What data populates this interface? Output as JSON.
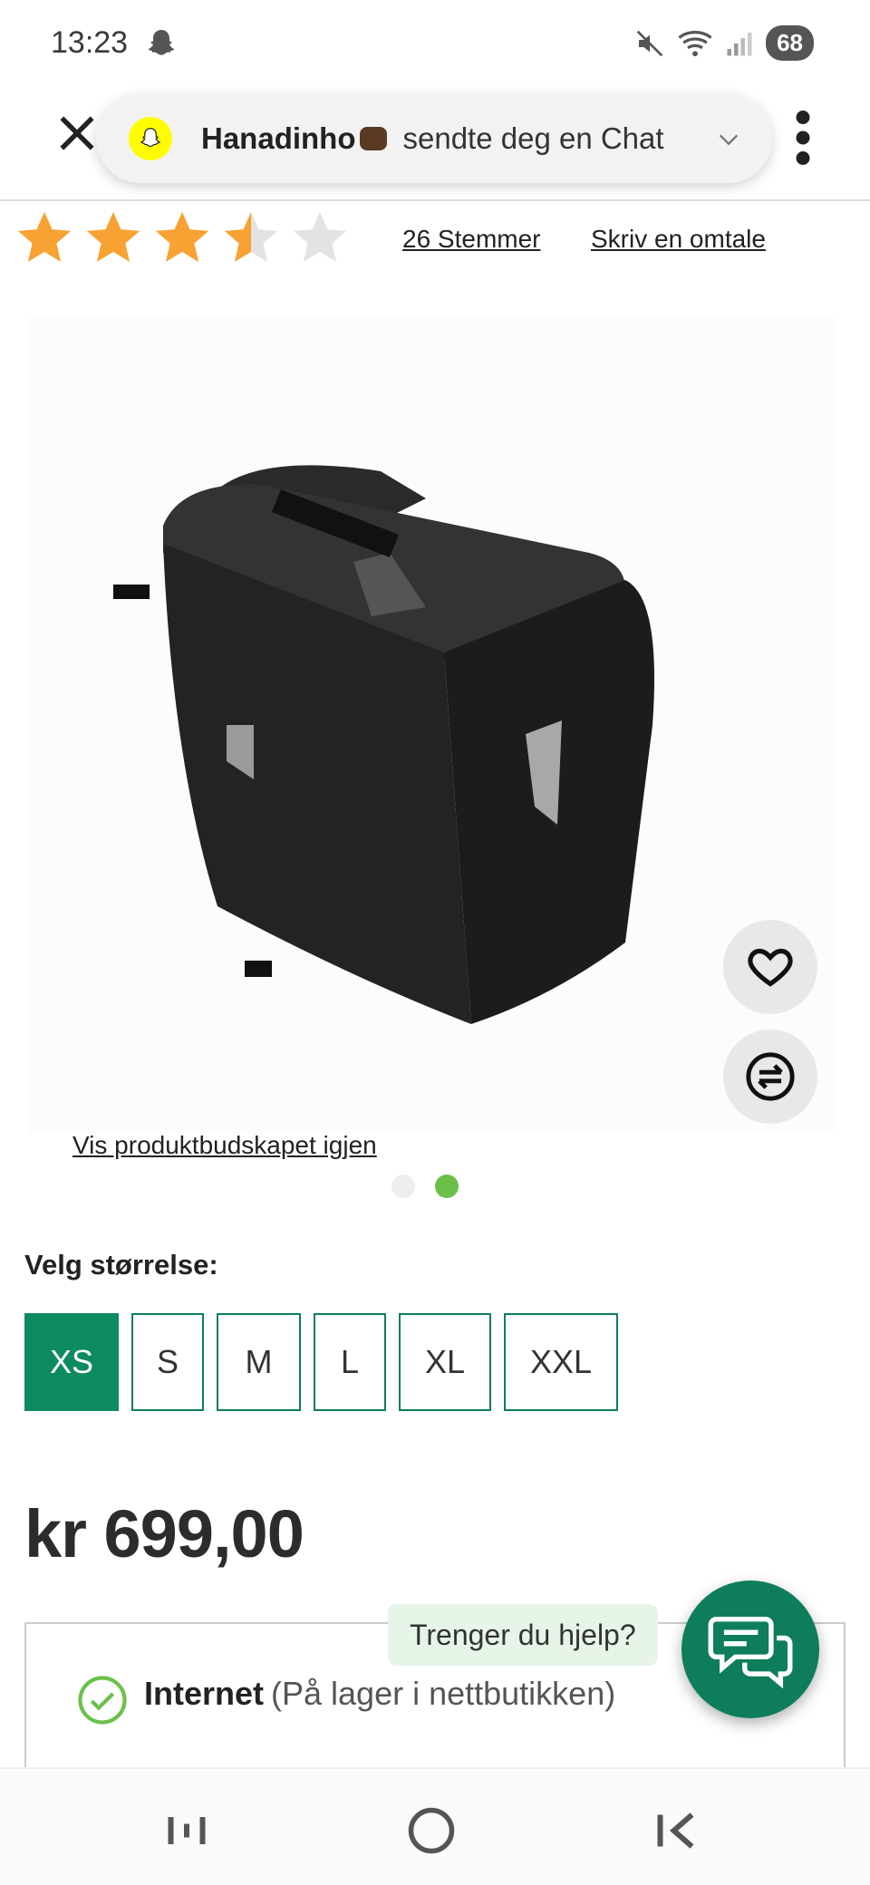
{
  "status_bar": {
    "time": "13:23",
    "battery": "68",
    "icons": [
      "snapchat-ghost-icon",
      "mute-icon",
      "wifi-icon",
      "signal-icon"
    ]
  },
  "notification": {
    "app_icon": "snapchat-logo-icon",
    "sender": "Hanadinho",
    "message": "sendte deg en Chat"
  },
  "rating": {
    "stars_filled": 3.5,
    "stars_total": 5,
    "votes_label": "26 Stemmer",
    "review_label": "Skriv en omtale"
  },
  "product": {
    "image_alt": "black pet carrier bag",
    "show_message_link": "Vis produktbudskapet igjen",
    "carousel_active": 2,
    "carousel_total": 2
  },
  "size": {
    "label": "Velg størrelse:",
    "options": [
      "XS",
      "S",
      "M",
      "L",
      "XL",
      "XXL"
    ],
    "selected": "XS"
  },
  "price": "kr 699,00",
  "stock": {
    "channel": "Internet",
    "note": "(På lager i nettbutikken)"
  },
  "help": {
    "bubble_text": "Trenger du hjelp?"
  },
  "colors": {
    "brand_green": "#0e8a63",
    "star_orange": "#f7a233",
    "dot_active": "#6cc04a"
  }
}
